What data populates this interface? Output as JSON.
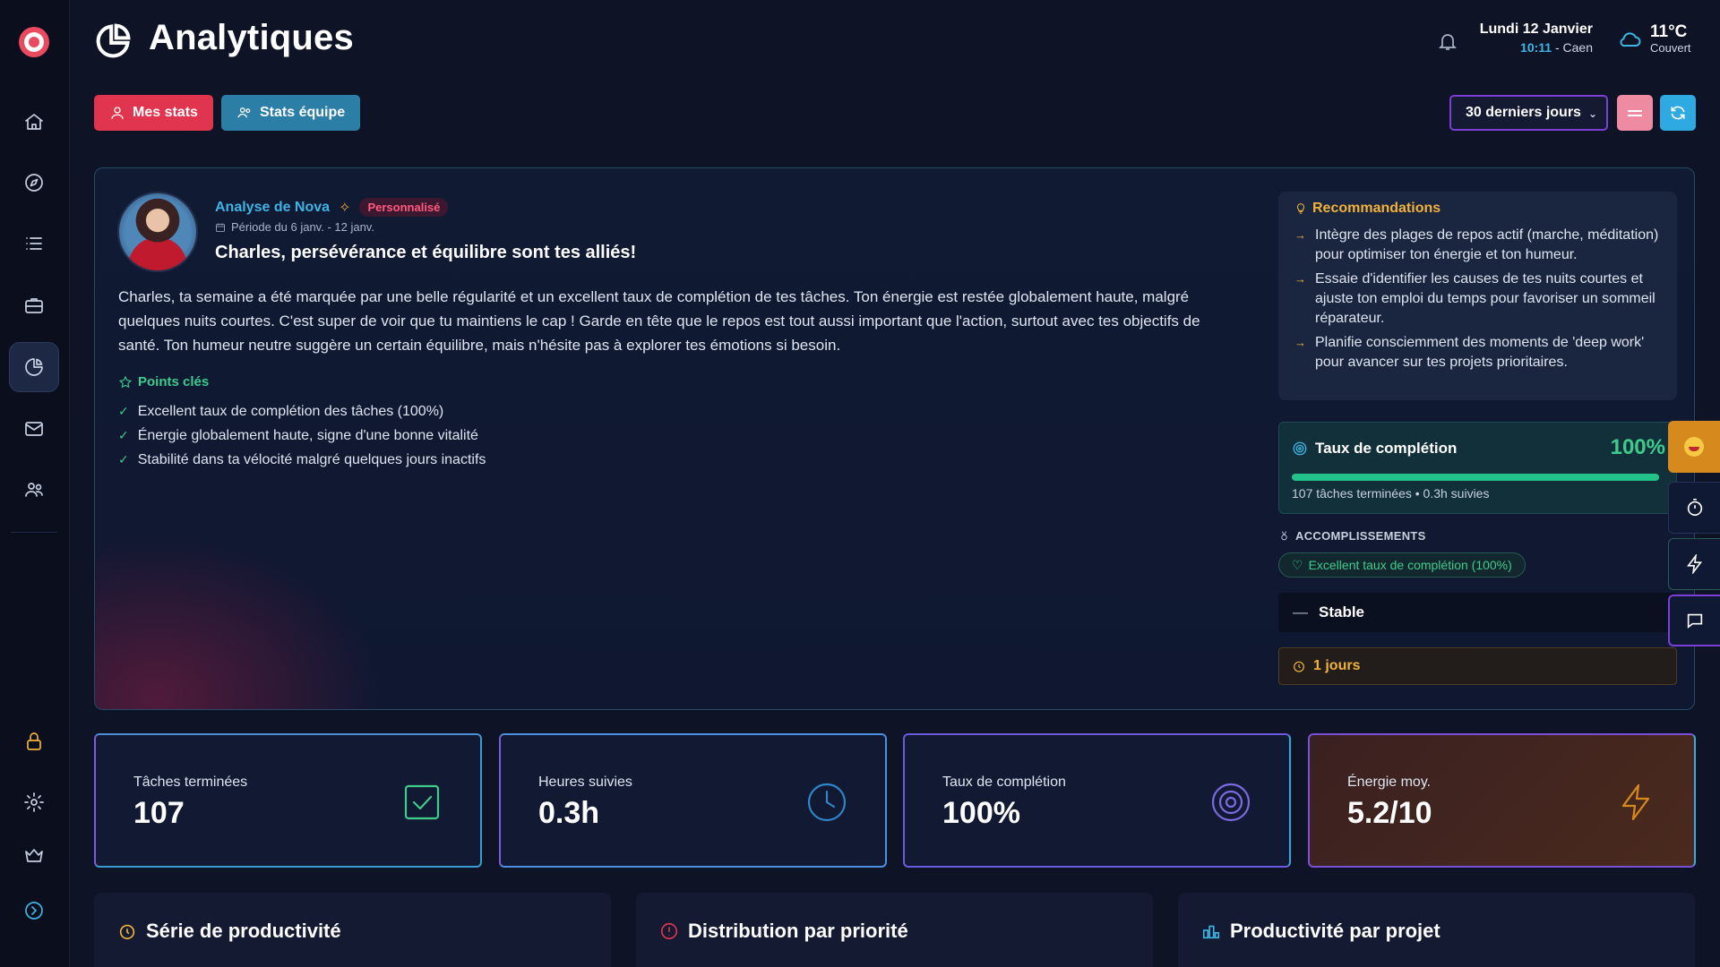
{
  "header": {
    "title": "Analytiques",
    "date": "Lundi 12 Janvier",
    "time": "10:11",
    "location": "- Caen",
    "temperature": "11°C",
    "weather": "Couvert"
  },
  "toolbar": {
    "my_stats": "Mes stats",
    "team_stats": "Stats équipe",
    "period": "30 derniers jours"
  },
  "analysis": {
    "author": "Analyse de Nova",
    "badge": "Personnalisé",
    "period": "Période du 6 janv. - 12 janv.",
    "headline": "Charles, persévérance et équilibre sont tes alliés!",
    "body": "Charles, ta semaine a été marquée par une belle régularité et un excellent taux de complétion de tes tâches. Ton énergie est restée globalement haute, malgré quelques nuits courtes. C'est super de voir que tu maintiens le cap ! Garde en tête que le repos est tout aussi important que l'action, surtout avec tes objectifs de santé. Ton humeur neutre suggère un certain équilibre, mais n'hésite pas à explorer tes émotions si besoin.",
    "points_title": "Points clés",
    "points": [
      "Excellent taux de complétion des tâches (100%)",
      "Énergie globalement haute, signe d'une bonne vitalité",
      "Stabilité dans ta vélocité malgré quelques jours inactifs"
    ]
  },
  "recommendations": {
    "title": "Recommandations",
    "items": [
      "Intègre des plages de repos actif (marche, méditation) pour optimiser ton énergie et ton humeur.",
      "Essaie d'identifier les causes de tes nuits courtes et ajuste ton emploi du temps pour favoriser un sommeil réparateur.",
      "Planifie consciemment des moments de 'deep work' pour avancer sur tes projets prioritaires."
    ]
  },
  "completion": {
    "label": "Taux de complétion",
    "value": "100%",
    "progress": 1.0,
    "sub": "107 tâches terminées • 0.3h suivies"
  },
  "achievements": {
    "title": "ACCOMPLISSEMENTS",
    "badge": "Excellent taux de complétion (100%)"
  },
  "trend": {
    "dash": "—",
    "label": "Stable"
  },
  "streak": {
    "label": "1 jours"
  },
  "stats": [
    {
      "label": "Tâches terminées",
      "value": "107"
    },
    {
      "label": "Heures suivies",
      "value": "0.3h"
    },
    {
      "label": "Taux de complétion",
      "value": "100%"
    },
    {
      "label": "Énergie moy.",
      "value": "5.2/10"
    }
  ],
  "panels": {
    "streak": "Série de productivité",
    "priority": "Distribution par priorité",
    "project": "Productivité par projet"
  },
  "colors": {
    "accent_pink": "#e0344f",
    "accent_blue": "#3eb4e6",
    "accent_green": "#3ecb8c",
    "accent_orange": "#f0b23a",
    "accent_purple": "#7b3fd8"
  },
  "icons": {
    "sidebar": [
      "home-icon",
      "compass-icon",
      "list-icon",
      "briefcase-icon",
      "analytics-icon",
      "mail-icon",
      "team-icon",
      "lock-icon",
      "settings-icon",
      "crown-icon",
      "expand-icon"
    ],
    "dock": [
      "emoji-icon",
      "timer-icon",
      "lightning-icon",
      "chat-icon"
    ]
  }
}
